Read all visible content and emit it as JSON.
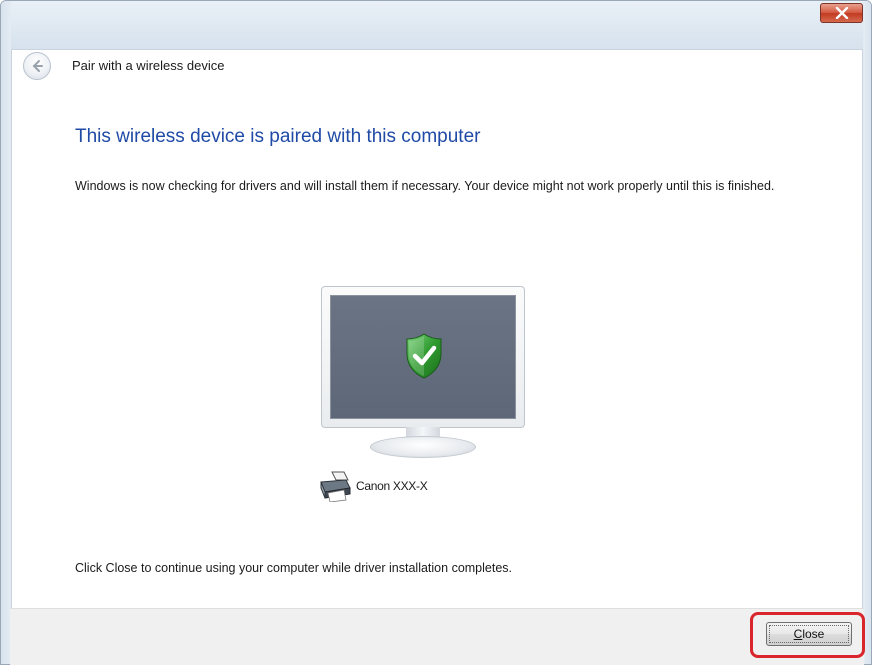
{
  "window": {
    "title": "Pair with a wireless device",
    "close_icon": "close-icon"
  },
  "main": {
    "heading": "This wireless device is paired with this computer",
    "description": "Windows is now checking for drivers and will install them if necessary. Your device might not work properly until this is finished.",
    "device_label": "Canon XXX-X",
    "footer_text": "Click Close to continue using your computer while driver installation completes."
  },
  "buttons": {
    "close_accesskey": "C",
    "close_rest": "lose"
  },
  "icons": {
    "back": "back-arrow-icon",
    "monitor": "monitor-icon",
    "shield": "shield-check-icon",
    "printer": "printer-icon"
  },
  "colors": {
    "heading": "#1f4aa6",
    "highlight": "#d9262c",
    "shield": "#2f9b2f"
  }
}
